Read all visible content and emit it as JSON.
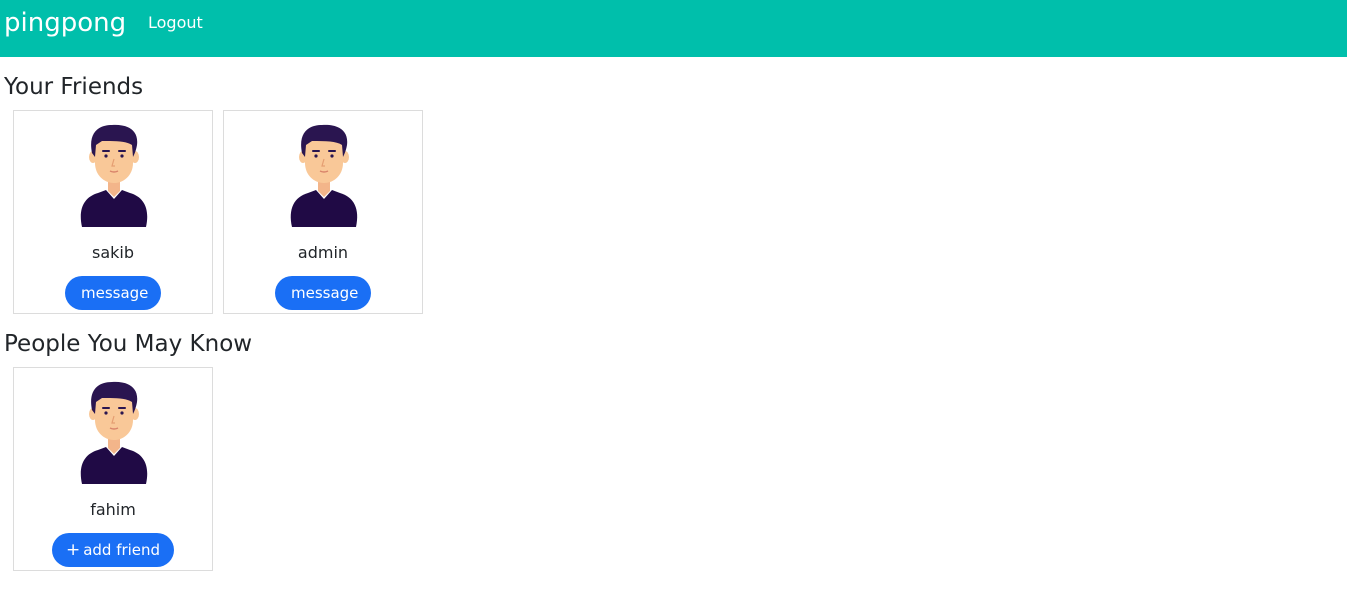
{
  "navbar": {
    "brand": "pingpong",
    "logout_label": "Logout"
  },
  "friends_section": {
    "title": "Your Friends",
    "friends": [
      {
        "name": "sakib",
        "action_label": "message"
      },
      {
        "name": "admin",
        "action_label": "message"
      }
    ]
  },
  "suggestions_section": {
    "title": "People You May Know",
    "people": [
      {
        "name": "fahim",
        "action_icon": "plus-icon",
        "action_label": "add friend"
      }
    ]
  },
  "colors": {
    "navbar": "#00bfab",
    "button": "#1a6ff5",
    "avatar_hair": "#2a1550",
    "avatar_shirt": "#200a45",
    "avatar_skin": "#f9c898"
  }
}
